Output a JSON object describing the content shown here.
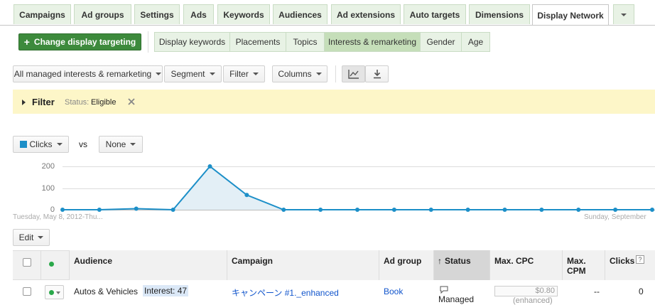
{
  "tabs": [
    {
      "label": "Campaigns"
    },
    {
      "label": "Ad groups"
    },
    {
      "label": "Settings"
    },
    {
      "label": "Ads"
    },
    {
      "label": "Keywords"
    },
    {
      "label": "Audiences"
    },
    {
      "label": "Ad extensions"
    },
    {
      "label": "Auto targets"
    },
    {
      "label": "Dimensions"
    },
    {
      "label": "Display Network"
    }
  ],
  "active_tab": "Display Network",
  "change_targeting_label": "Change display targeting",
  "subtabs": [
    {
      "label": "Display keywords"
    },
    {
      "label": "Placements"
    },
    {
      "label": "Topics"
    },
    {
      "label": "Interests & remarketing"
    },
    {
      "label": "Gender"
    },
    {
      "label": "Age"
    }
  ],
  "active_subtab": "Interests & remarketing",
  "toolbar": {
    "view_filter": "All managed interests & remarketing",
    "segment": "Segment",
    "filter": "Filter",
    "columns": "Columns"
  },
  "filter_bar": {
    "label": "Filter",
    "status_label": "Status:",
    "status_value": "Eligible",
    "close_icon": "close-icon"
  },
  "chart_controls": {
    "metric1": "Clicks",
    "vs": "vs",
    "metric2": "None"
  },
  "chart_data": {
    "type": "line",
    "series": [
      {
        "name": "Clicks",
        "color": "#1c8fc8",
        "values": [
          0,
          0,
          5,
          0,
          200,
          68,
          0,
          0,
          0,
          0,
          0,
          0,
          0,
          0,
          0,
          0,
          0
        ]
      }
    ],
    "y_ticks": [
      "200",
      "100",
      "0"
    ],
    "ylim": [
      0,
      200
    ],
    "x_start_label": "Tuesday, May 8, 2012-Thu...",
    "x_end_label": "Sunday, September",
    "grid": true
  },
  "edit_label": "Edit",
  "table": {
    "columns": [
      "Audience",
      "Campaign",
      "Ad group",
      "Status",
      "Max. CPC",
      "Max. CPM",
      "Clicks"
    ],
    "help_icon": "?",
    "rows": [
      {
        "audience": "Autos & Vehicles",
        "interest_badge": "Interest: 47",
        "campaign": "キャンペーン #1._enhanced",
        "ad_group": "Book",
        "status": "Managed",
        "max_cpc": "$0.80",
        "max_cpc_note": "(enhanced)",
        "max_cpm": "--",
        "clicks": "0"
      }
    ]
  },
  "colors": {
    "accent_green": "#3d8a3c",
    "tab_green": "#e8f2e5",
    "filter_bg": "#fdf6c8",
    "line_blue": "#1c8fc8",
    "link_blue": "#1155cc",
    "status_dot": "#2aa84a"
  }
}
